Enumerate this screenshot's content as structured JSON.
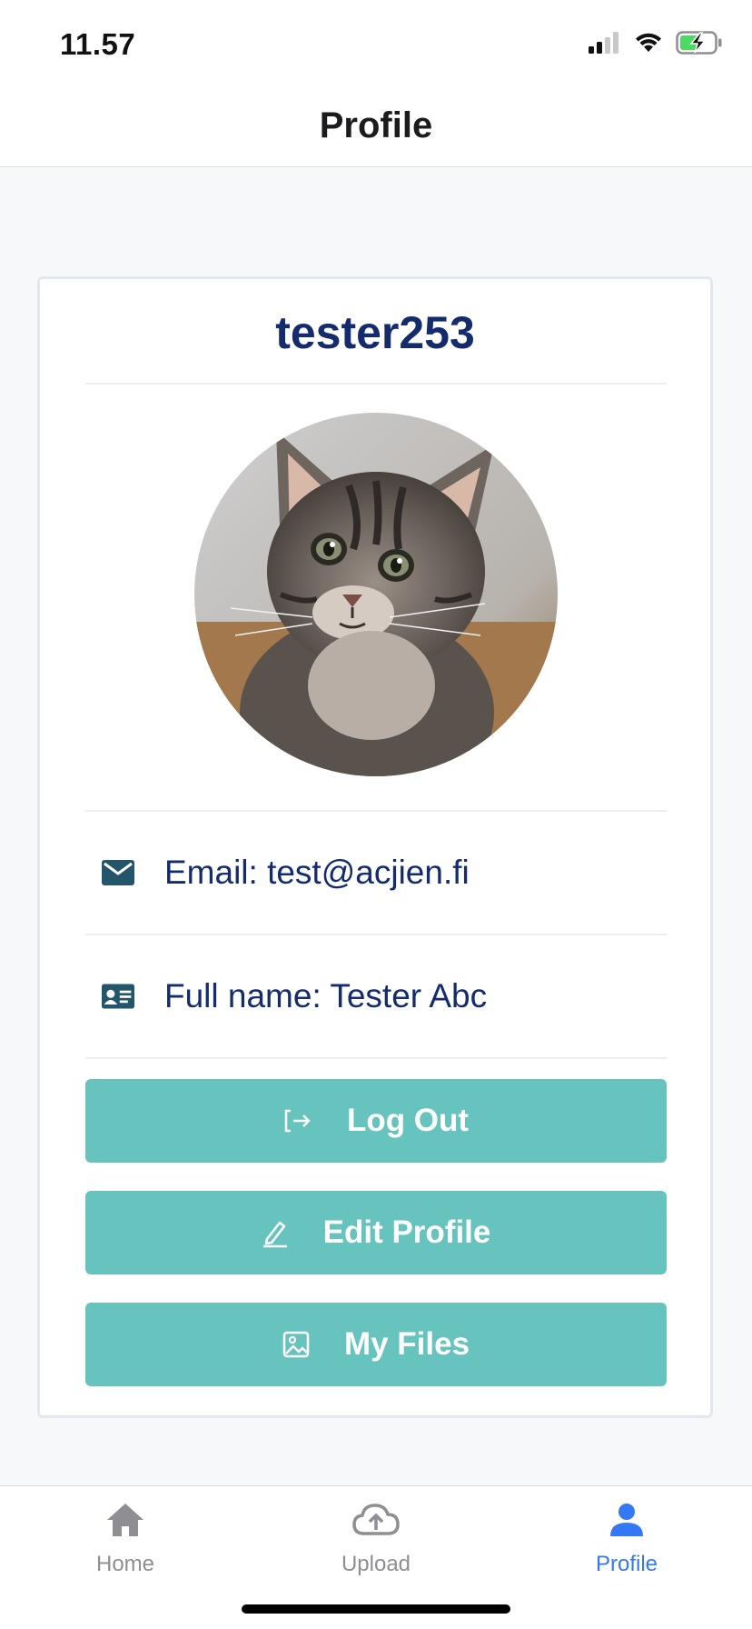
{
  "status_bar": {
    "time": "11.57"
  },
  "header": {
    "title": "Profile"
  },
  "profile": {
    "username": "tester253",
    "email_line": "Email: test@acjien.fi",
    "fullname_line": "Full name: Tester Abc"
  },
  "buttons": {
    "logout_label": "Log Out",
    "edit_label": "Edit Profile",
    "files_label": "My Files"
  },
  "tabs": [
    {
      "label": "Home",
      "icon": "home-icon"
    },
    {
      "label": "Upload",
      "icon": "cloud-upload-icon"
    },
    {
      "label": "Profile",
      "icon": "person-icon"
    }
  ],
  "colors": {
    "accent": "#67c3bd",
    "username": "#142c6e",
    "tab_active": "#3478f6",
    "tab_inactive": "#8e8e93"
  }
}
